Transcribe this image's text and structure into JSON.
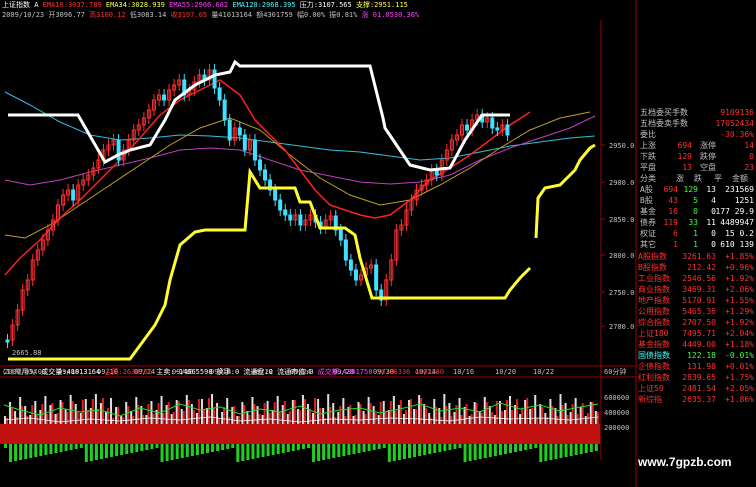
{
  "header": {
    "index_name": "上证指数",
    "mode": "A",
    "ma10": "EMA10:3037.789",
    "ma34": "EMA34:3028.939",
    "ma55": "EMA55:2966.682",
    "ma120": "EMA120:2968.395",
    "pressure": "压力:3107.565",
    "support": "支撑:2951.115",
    "date": "2009/10/23",
    "open": "开3096.77",
    "high": "高3100.12",
    "low": "低3083.14",
    "close": "收3107.05",
    "volume": "量41013164",
    "amount": "额4301759",
    "change": "幅0.00%",
    "amplitude": "振0.81%",
    "rise": "涨 01.0530.36%"
  },
  "price_labels": {
    "low_mark": "2665.88"
  },
  "y_axis": [
    "2950.0",
    "2900.0",
    "2850.0",
    "2800.0",
    "2750.0",
    "2700.0"
  ],
  "x_axis": [
    "2009/09/01",
    "09/08",
    "09/10",
    "09/14",
    "09/16",
    "09/18",
    "09/22",
    "09/24",
    "09/28",
    "09/30",
    "10/14",
    "10/16",
    "10/20",
    "10/22"
  ],
  "period": "60分钟",
  "volume_header": {
    "title": "(1)常用3A",
    "vol": "成交量:41013164",
    "main_buy": "主买:2634756",
    "main_sell": "主卖:-14665598",
    "turnover": "换手:0",
    "circ": "流通盘:0",
    "circ_mkt": "流通市值:0",
    "amt": "成交额:4301758",
    "v2": "56700336",
    "v3": "4902280"
  },
  "volume_axis": [
    "600000",
    "400000",
    "200000"
  ],
  "panel": {
    "title1": "五档委买手数",
    "title1_val": "9109136",
    "title2": "五档委卖手数",
    "title2_val": "17052434",
    "ratio_label": "委比",
    "ratio_val": "-30.36%",
    "stats": [
      {
        "a": "上涨",
        "b": "694",
        "c": "涨停",
        "d": "14"
      },
      {
        "a": "下跌",
        "b": "129",
        "c": "跌停",
        "d": "0"
      },
      {
        "a": "平盘",
        "b": "13",
        "c": "空盘",
        "d": "23"
      }
    ],
    "cat_header": [
      "分类",
      "涨",
      "跌",
      "平",
      "金额"
    ],
    "cats": [
      {
        "n": "A股",
        "u": "694",
        "d": "129",
        "f": "13",
        "a": "231569"
      },
      {
        "n": "B股",
        "u": "43",
        "d": "5",
        "f": "4",
        "a": "1251"
      },
      {
        "n": "基金",
        "u": "16",
        "d": "0",
        "f": "0",
        "a": "177 29.9"
      },
      {
        "n": "债券",
        "u": "119",
        "d": "33",
        "f": "11",
        "a": "4489947"
      },
      {
        "n": "权证",
        "u": "6",
        "d": "1",
        "f": "0",
        "a": "15 0.2"
      },
      {
        "n": "其它",
        "u": "1",
        "d": "1",
        "f": "0",
        "a": "610 139"
      }
    ],
    "indices": [
      {
        "n": "A股指数",
        "v": "3261.63",
        "p": "+1.85%"
      },
      {
        "n": "B股指数",
        "v": "212.42",
        "p": "+0.96%"
      },
      {
        "n": "工业指数",
        "v": "2546.56",
        "p": "+1.92%"
      },
      {
        "n": "商业指数",
        "v": "3469.31",
        "p": "+2.06%"
      },
      {
        "n": "地产指数",
        "v": "5170.91",
        "p": "+1.55%"
      },
      {
        "n": "公用指数",
        "v": "5465.36",
        "p": "+1.29%"
      },
      {
        "n": "综合指数",
        "v": "2707.50",
        "p": "+1.92%"
      },
      {
        "n": "上证180",
        "v": "7495.71",
        "p": "+2.04%"
      },
      {
        "n": "基金指数",
        "v": "4449.00",
        "p": "+1.18%"
      },
      {
        "n": "国债指数",
        "v": "122.18",
        "p": "-0.01%"
      },
      {
        "n": "企债指数",
        "v": "131.98",
        "p": "+0.01%"
      },
      {
        "n": "红利指数",
        "v": "2839.65",
        "p": "+1.75%"
      },
      {
        "n": "上证50",
        "v": "2481.54",
        "p": "+2.05%"
      },
      {
        "n": "新综指",
        "v": "2635.37",
        "p": "+1.86%"
      }
    ]
  },
  "watermark": "www.7gpzb.com"
}
